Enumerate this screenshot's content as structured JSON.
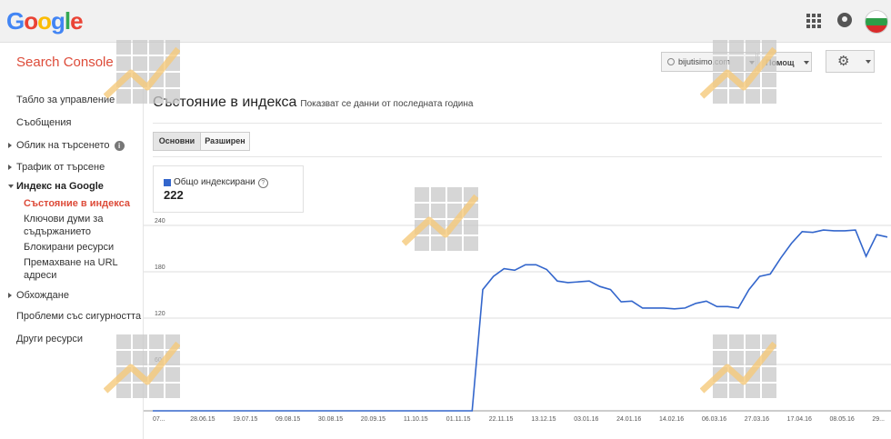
{
  "header": {
    "logo_letters": [
      {
        "ch": "G",
        "color": "#4285f4"
      },
      {
        "ch": "o",
        "color": "#ea4335"
      },
      {
        "ch": "o",
        "color": "#fbbc05"
      },
      {
        "ch": "g",
        "color": "#4285f4"
      },
      {
        "ch": "l",
        "color": "#34a853"
      },
      {
        "ch": "e",
        "color": "#ea4335"
      }
    ],
    "apps_icon": "apps-grid-icon",
    "notifications_icon": "bell-icon",
    "avatar_colors": [
      "#ffffff",
      "#2e9e48",
      "#d92b2b"
    ]
  },
  "product": {
    "title": "Search Console"
  },
  "sidebar": {
    "items": [
      {
        "label": "Табло за управление"
      },
      {
        "label": "Съобщения"
      },
      {
        "label": "Облик на търсенето"
      },
      {
        "label": "Трафик от търсене"
      },
      {
        "label": "Индекс на Google"
      },
      {
        "label": "Състояние в индекса"
      },
      {
        "label": "Ключови думи за съдържанието"
      },
      {
        "label": "Блокирани ресурси"
      },
      {
        "label": "Премахване на URL адреси"
      },
      {
        "label": "Обхождане"
      },
      {
        "label": "Проблеми със сигурността"
      },
      {
        "label": "Други ресурси"
      }
    ]
  },
  "toolbar": {
    "site_label": "bijutisimo.com",
    "help_label": "Помощ",
    "settings_icon": "gear-icon"
  },
  "page": {
    "title": "Състояние в индекса",
    "subtitle": "Показват се данни от последната година",
    "tabs": [
      {
        "label": "Основни"
      },
      {
        "label": "Разширен"
      }
    ],
    "stat_label": "Общо индексирани",
    "stat_value": "222",
    "accent": "#3366cc"
  },
  "chart_data": {
    "type": "line",
    "series": [
      {
        "name": "Общо индексирани",
        "color": "#3366cc",
        "values": [
          0,
          0,
          0,
          0,
          0,
          0,
          0,
          0,
          0,
          0,
          0,
          0,
          0,
          0,
          0,
          0,
          0,
          0,
          0,
          0,
          0,
          0,
          0,
          0,
          0,
          0,
          0,
          0,
          0,
          0,
          0,
          157,
          174,
          184,
          182,
          189,
          189,
          183,
          168,
          166,
          167,
          168,
          161,
          157,
          141,
          142,
          133,
          133,
          133,
          132,
          133,
          139,
          142,
          135,
          135,
          133,
          157,
          174,
          177,
          198,
          217,
          232,
          231,
          234,
          233,
          233,
          234,
          200,
          228,
          225
        ]
      }
    ],
    "x_tick_labels": [
      "07...",
      "28.06.15",
      "19.07.15",
      "09.08.15",
      "30.08.15",
      "20.09.15",
      "11.10.15",
      "01.11.15",
      "22.11.15",
      "13.12.15",
      "03.01.16",
      "24.01.16",
      "14.02.16",
      "06.03.16",
      "27.03.16",
      "17.04.16",
      "08.05.16",
      "29..."
    ],
    "y_ticks": [
      0,
      60,
      120,
      180,
      240
    ],
    "y_tick_labels": [
      "",
      "60",
      "120",
      "180",
      "240"
    ],
    "ylim": [
      0,
      240
    ],
    "grid": true
  }
}
